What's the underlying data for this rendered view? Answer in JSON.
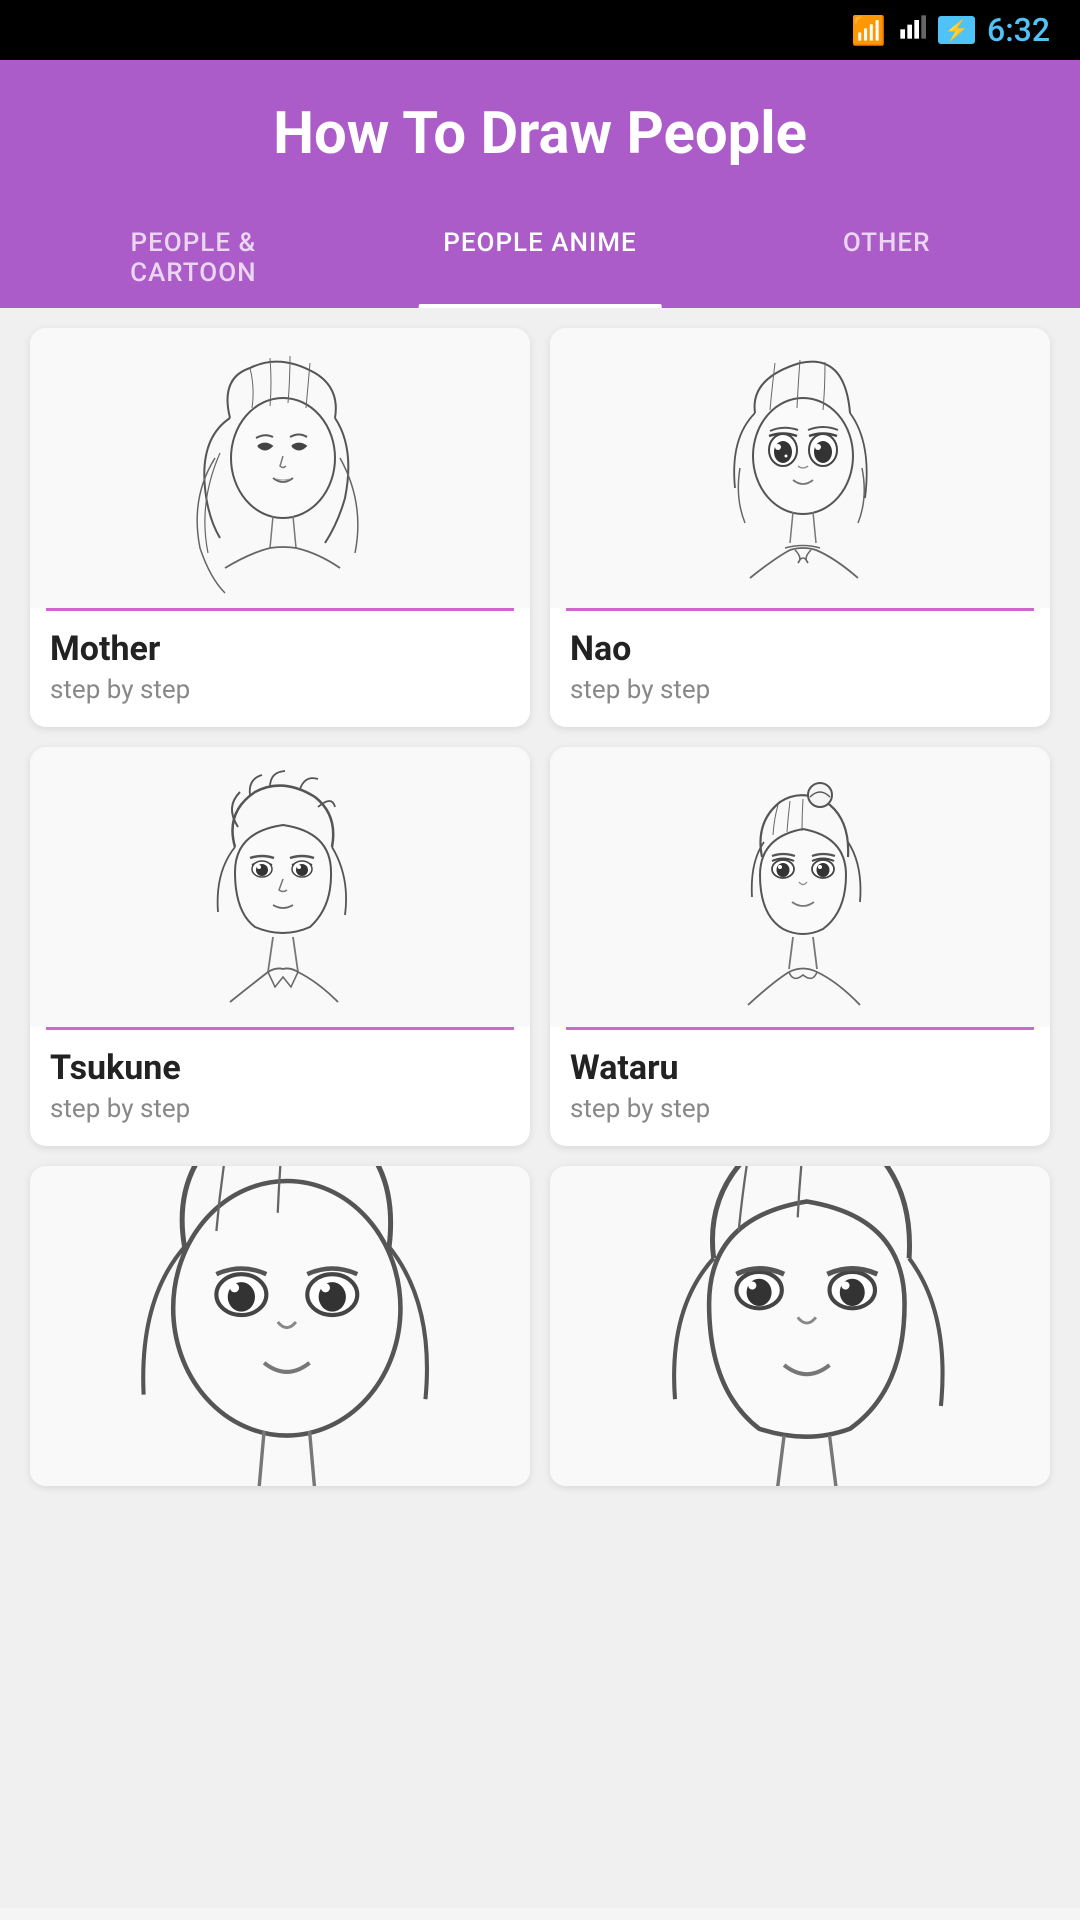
{
  "statusBar": {
    "time": "6:32"
  },
  "header": {
    "title": "How To Draw People"
  },
  "tabs": [
    {
      "id": "people-cartoon",
      "label": "PEOPLE &\nCARTOON",
      "active": false
    },
    {
      "id": "people-anime",
      "label": "PEOPLE ANIME",
      "active": true
    },
    {
      "id": "other",
      "label": "OTHER",
      "active": false
    }
  ],
  "cards": [
    {
      "id": "mother",
      "title": "Mother",
      "subtitle": "step by step"
    },
    {
      "id": "nao",
      "title": "Nao",
      "subtitle": "step by step"
    },
    {
      "id": "tsukune",
      "title": "Tsukune",
      "subtitle": "step by step"
    },
    {
      "id": "wataru",
      "title": "Wataru",
      "subtitle": "step by step"
    }
  ],
  "partialCards": [
    {
      "id": "partial-left",
      "visible": true
    },
    {
      "id": "partial-right",
      "visible": true
    }
  ],
  "colors": {
    "purple": "#ab5cc8",
    "pink": "#d066d0",
    "tabUnderline": "#ffffff"
  }
}
